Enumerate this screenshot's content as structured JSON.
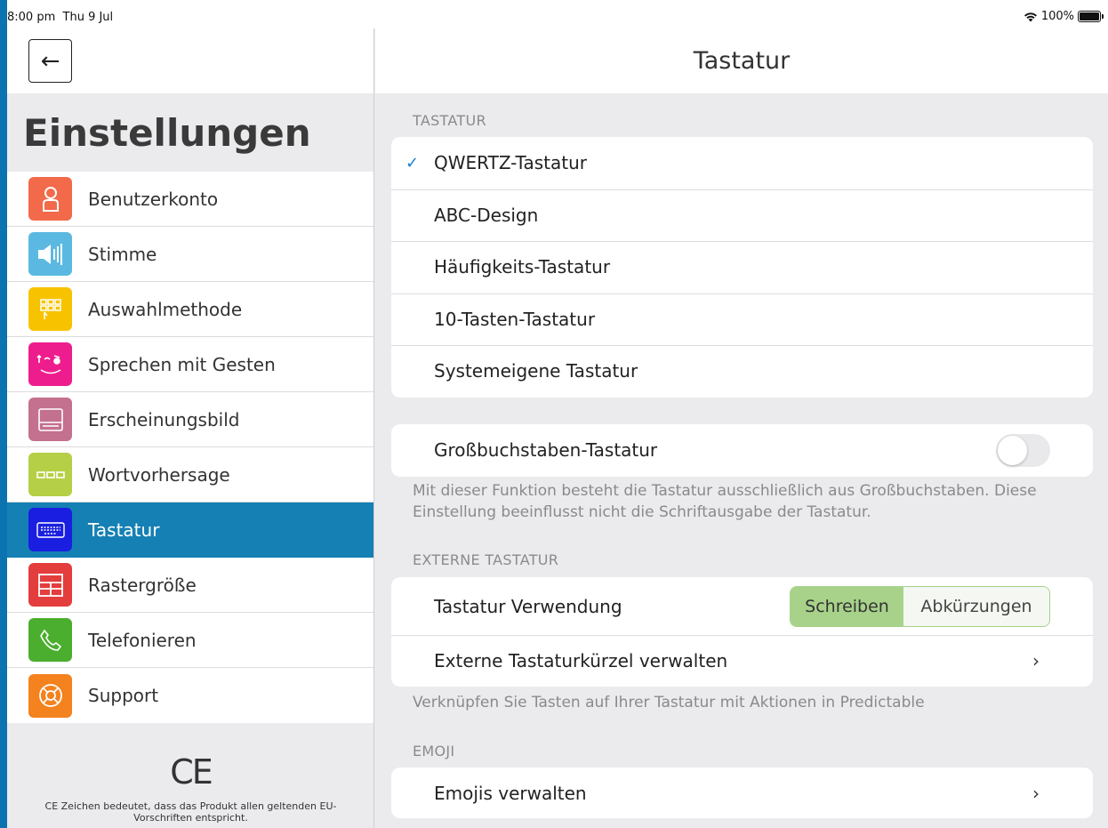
{
  "status": {
    "time": "8:00 pm",
    "date": "Thu 9 Jul",
    "battery": "100%"
  },
  "sidebar": {
    "back_icon": "arrow-left-icon",
    "title": "Einstellungen",
    "items": [
      {
        "label": "Benutzerkonto",
        "color": "#f26a4a",
        "icon": "person-icon"
      },
      {
        "label": "Stimme",
        "color": "#5bb9e1",
        "icon": "speaker-icon"
      },
      {
        "label": "Auswahlmethode",
        "color": "#f7c300",
        "icon": "grid-select-icon"
      },
      {
        "label": "Sprechen mit Gesten",
        "color": "#ee1d8e",
        "icon": "face-gesture-icon"
      },
      {
        "label": "Erscheinungsbild",
        "color": "#c4708f",
        "icon": "appearance-icon"
      },
      {
        "label": "Wortvorhersage",
        "color": "#b5cf46",
        "icon": "word-prediction-icon"
      },
      {
        "label": "Tastatur",
        "color": "#1a1ee0",
        "icon": "keyboard-icon",
        "active": true
      },
      {
        "label": "Rastergröße",
        "color": "#e33d3d",
        "icon": "grid-size-icon"
      },
      {
        "label": "Telefonieren",
        "color": "#4bae2e",
        "icon": "phone-icon"
      },
      {
        "label": "Support",
        "color": "#f4821e",
        "icon": "lifebuoy-icon"
      }
    ],
    "ce_mark": "CE",
    "ce_text": "CE Zeichen bedeutet, dass das Produkt allen geltenden EU-Vorschriften entspricht."
  },
  "main": {
    "title": "Tastatur",
    "keyboard_section": {
      "label": "TASTATUR",
      "options": [
        "QWERTZ-Tastatur",
        "ABC-Design",
        "Häufigkeits-Tastatur",
        "10-Tasten-Tastatur",
        "Systemeigene Tastatur"
      ],
      "selected": "QWERTZ-Tastatur"
    },
    "caps": {
      "label": "Großbuchstaben-Tastatur",
      "enabled": false,
      "footnote": "Mit dieser Funktion besteht die Tastatur ausschließlich aus Großbuchstaben. Diese Einstellung beeinflusst nicht die Schriftausgabe der Tastatur."
    },
    "external": {
      "label": "EXTERNE TASTATUR",
      "usage_label": "Tastatur Verwendung",
      "seg_write": "Schreiben",
      "seg_abbr": "Abkürzungen",
      "selected": "Schreiben",
      "shortcuts_label": "Externe Tastaturkürzel verwalten",
      "footnote": "Verknüpfen Sie Tasten auf Ihrer Tastatur mit Aktionen in Predictable"
    },
    "emoji": {
      "label": "EMOJI",
      "manage_label": "Emojis verwalten"
    }
  }
}
